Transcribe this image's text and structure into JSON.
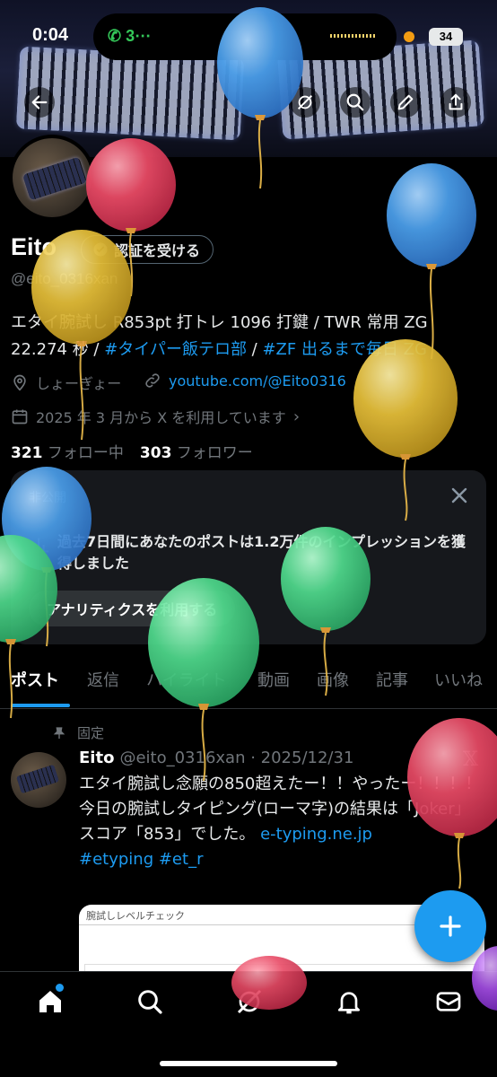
{
  "status_bar": {
    "time": "0:04",
    "call": "3⋯",
    "battery": "34"
  },
  "profile": {
    "name": "Eito",
    "verify_label": "認証を受ける",
    "handle": "@eito_0316xan",
    "bio_text": "エタイ腕試し R853pt 打トレ 1096 打鍵 / TWR 常用 ZG 22.274 秒 / ",
    "bio_tag1": "#タイパー飯テロ部",
    "bio_sep": " / ",
    "bio_tag2": "#ZF 出るまで毎日 ZG",
    "location": "しょーぎょー",
    "url": "youtube.com/@Eito0316",
    "joined": "2025 年 3 月から X を利用しています",
    "following_count": "321",
    "following_label": "フォロー中",
    "followers_count": "303",
    "followers_label": "フォロワー"
  },
  "analytics_card": {
    "private_label": "非公開",
    "message": "過去7日間にあなたのポストは1.2万件のインプレッションを獲得しました",
    "button": "アナリティクスを利用する"
  },
  "tabs": [
    "ポスト",
    "返信",
    "ハイライト",
    "動画",
    "画像",
    "記事",
    "いいね"
  ],
  "post": {
    "pinned_label": "固定",
    "author": "Eito",
    "handle_date": "@eito_0316xan · 2025/12/31",
    "line1": "エタイ腕試し念願の850超えたー！！やったー！！！！",
    "line2": "今日の腕試しタイピング(ローマ字)の結果は「Joker」スコア「853」でした。",
    "link": "e-typing.ne.jp",
    "tags": "#etyping #et_r",
    "image_title": "腕試しレベルチェック",
    "x_mark": "𝕏"
  },
  "colors": {
    "accent": "#1d9bf0",
    "background": "#000000",
    "card": "#16181c"
  },
  "icons": [
    "back-arrow-icon",
    "grok-icon",
    "search-icon",
    "edit-icon",
    "share-icon",
    "home-icon",
    "explore-icon",
    "grok-nav-icon",
    "bell-icon",
    "mail-icon",
    "pin-icon",
    "location-icon",
    "link-icon",
    "calendar-icon",
    "verified-check-icon",
    "close-icon",
    "plus-icon"
  ]
}
